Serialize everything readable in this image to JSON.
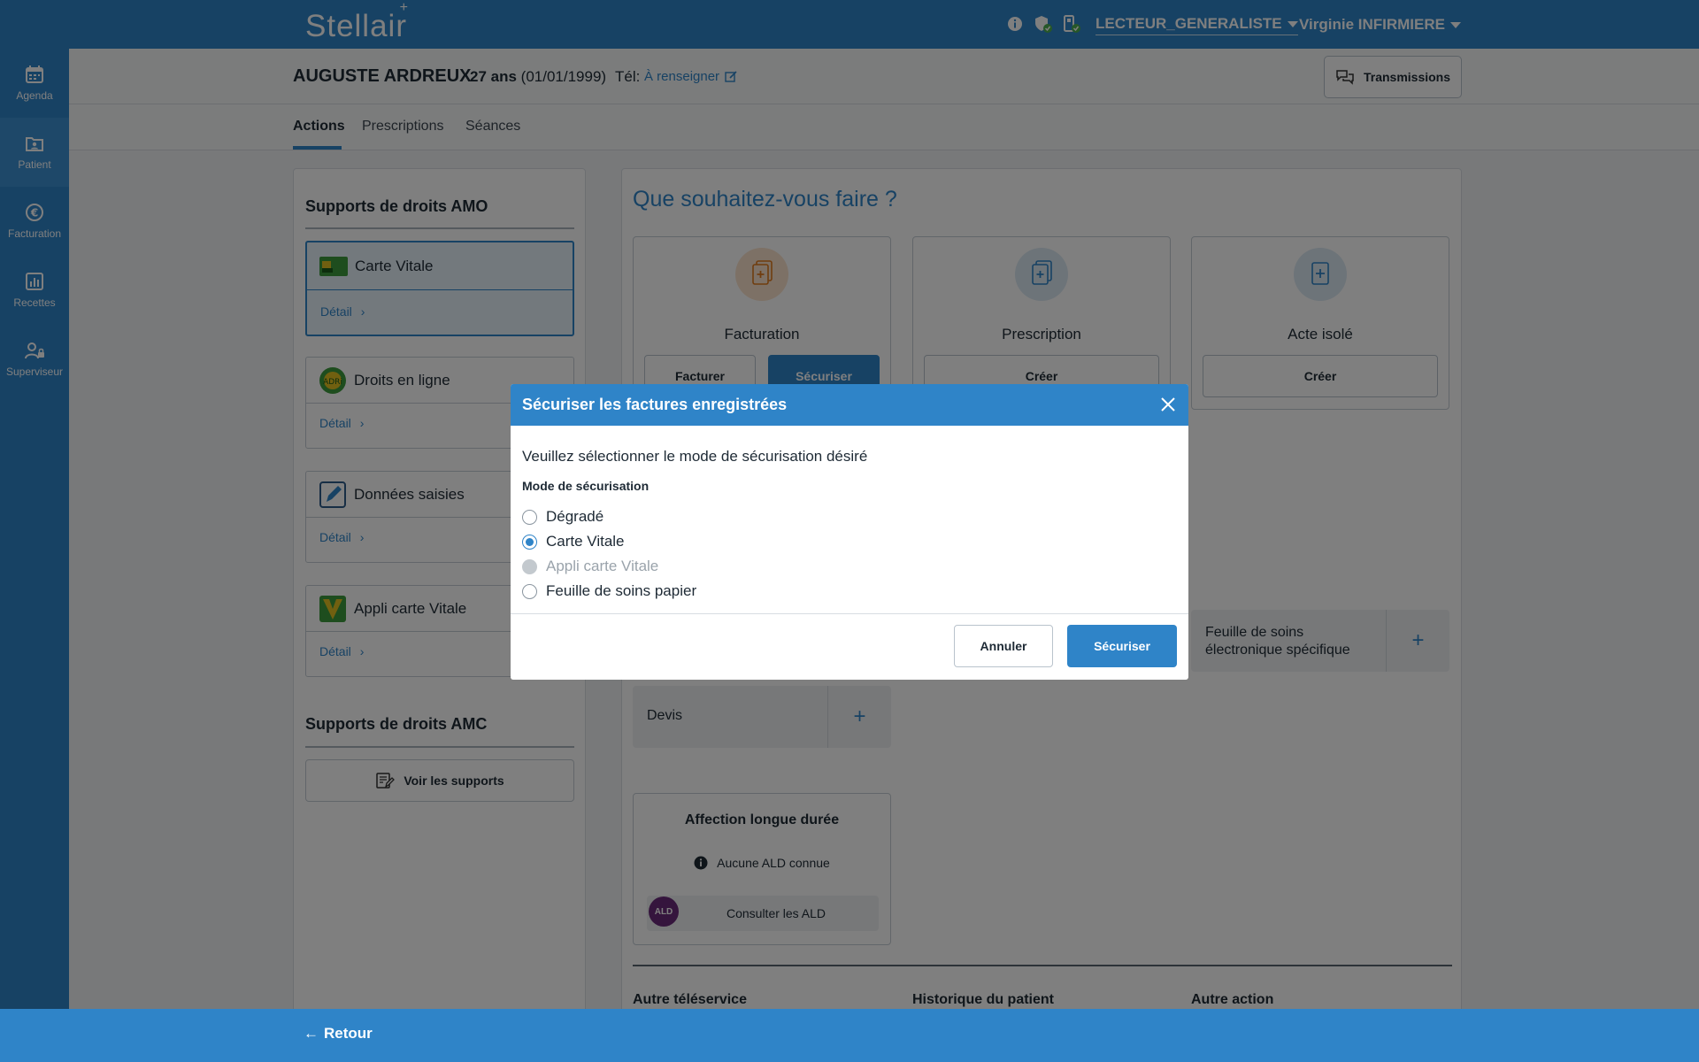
{
  "app": {
    "logo": "Stellair"
  },
  "topbar": {
    "reader": "LECTEUR_GENERALISTE",
    "user": "Virginie INFIRMIERE"
  },
  "sidebar": {
    "items": [
      {
        "label": "Agenda",
        "icon": "calendar-icon"
      },
      {
        "label": "Patient",
        "icon": "patient-icon"
      },
      {
        "label": "Facturation",
        "icon": "euro-icon"
      },
      {
        "label": "Recettes",
        "icon": "chart-icon"
      },
      {
        "label": "Superviseur",
        "icon": "supervisor-icon"
      }
    ]
  },
  "patient": {
    "name": "AUGUSTE ARDREUX",
    "age": "27 ans",
    "birthdate": "(01/01/1999)",
    "tel_label": "Tél:",
    "tel_value": "À renseigner",
    "transmissions": "Transmissions"
  },
  "tabs": [
    "Actions",
    "Prescriptions",
    "Séances"
  ],
  "left": {
    "amo_title": "Supports de droits AMO",
    "supports": [
      {
        "name": "Carte Vitale",
        "detail": "Détail"
      },
      {
        "name": "Droits en ligne",
        "detail": "Détail"
      },
      {
        "name": "Données saisies",
        "detail": "Détail"
      },
      {
        "name": "Appli carte Vitale",
        "detail": "Détail"
      }
    ],
    "amc_title": "Supports de droits AMC",
    "voir": "Voir les supports"
  },
  "right": {
    "question": "Que souhaitez-vous faire ?",
    "cards": [
      {
        "title": "Facturation",
        "buttons": [
          "Facturer",
          "Sécuriser"
        ]
      },
      {
        "title": "Prescription",
        "buttons": [
          "Créer"
        ]
      },
      {
        "title": "Acte isolé",
        "buttons": [
          "Créer"
        ]
      }
    ],
    "feuille": "Feuille de soins électronique spécifique",
    "devis": "Devis",
    "plus": "+",
    "ald": {
      "title": "Affection longue durée",
      "none": "Aucune ALD connue",
      "consult": "Consulter les ALD",
      "badge": "ALD"
    },
    "columns": [
      "Autre téléservice",
      "Historique du patient",
      "Autre action"
    ]
  },
  "footer": {
    "retour": "Retour"
  },
  "modal": {
    "title": "Sécuriser les factures enregistrées",
    "intro": "Veuillez sélectionner le mode de sécurisation désiré",
    "legend": "Mode de sécurisation",
    "options": [
      {
        "label": "Dégradé",
        "state": "unchecked"
      },
      {
        "label": "Carte Vitale",
        "state": "checked"
      },
      {
        "label": "Appli carte Vitale",
        "state": "disabled"
      },
      {
        "label": "Feuille de soins papier",
        "state": "unchecked"
      }
    ],
    "cancel": "Annuler",
    "confirm": "Sécuriser"
  },
  "colors": {
    "primary": "#2f84c8",
    "overlay": "rgba(0,0,0,0.5)"
  }
}
